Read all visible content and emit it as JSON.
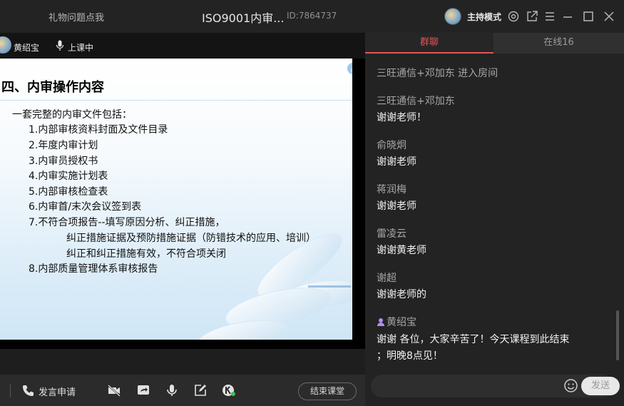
{
  "titlebar": {
    "left_text": "礼物问题点我",
    "title": "ISO9001内审...",
    "id_text": "ID:7864737",
    "mode_label": "主持模式",
    "icons": [
      "settings-icon",
      "share-icon",
      "menu-icon",
      "minimize-icon",
      "maximize-icon",
      "close-icon"
    ]
  },
  "teacher": {
    "name": "黄绍宝",
    "status": "上课中"
  },
  "slide": {
    "title": "四、内审操作内容",
    "intro": "一套完整的内审文件包括：",
    "items": [
      "1.内部审核资料封面及文件目录",
      "2.年度内审计划",
      "3.内审员授权书",
      "4.内审实施计划表",
      "5.内部审核检查表",
      "6.内审首/末次会议签到表",
      "7.不符合项报告--填写原因分析、纠正措施，",
      "纠正措施证据及预防措施证据（防错技术的应用、培训）",
      "纠正和纠正措施有效，不符合项关闭",
      "8.内部质量管理体系审核报告"
    ]
  },
  "toolbar": {
    "apply_label": "发言申请",
    "end_label": "结束课堂",
    "icons": [
      "phone-icon",
      "camera-off-icon",
      "screen-share-icon",
      "microphone-icon",
      "edit-icon",
      "k-app-icon"
    ]
  },
  "panel": {
    "tab_chat": "群聊",
    "tab_online": "在线16",
    "messages": [
      {
        "type": "system",
        "text": "三旺通信+邓加东 进入房间"
      },
      {
        "type": "chat",
        "name": "三旺通信+邓加东",
        "text": "谢谢老师！"
      },
      {
        "type": "chat",
        "name": "俞晓炯",
        "text": "谢谢老师"
      },
      {
        "type": "chat",
        "name": "蒋润梅",
        "text": "谢谢老师"
      },
      {
        "type": "chat",
        "name": "雷凌云",
        "text": "谢谢黄老师"
      },
      {
        "type": "chat",
        "name": "谢超",
        "text": "谢谢老师的"
      },
      {
        "type": "chat",
        "name": "黄绍宝",
        "text_line1": "谢谢 各位，大家辛苦了！今天课程到此结束",
        "text_line2": "；明晚8点见！",
        "is_teacher": true
      }
    ],
    "send_label": "发送",
    "input_placeholder": ""
  },
  "colors": {
    "accent": "#e65454",
    "background": "#1e1e1e",
    "panel": "#232323",
    "slide_blue": "#cfe6f6"
  }
}
